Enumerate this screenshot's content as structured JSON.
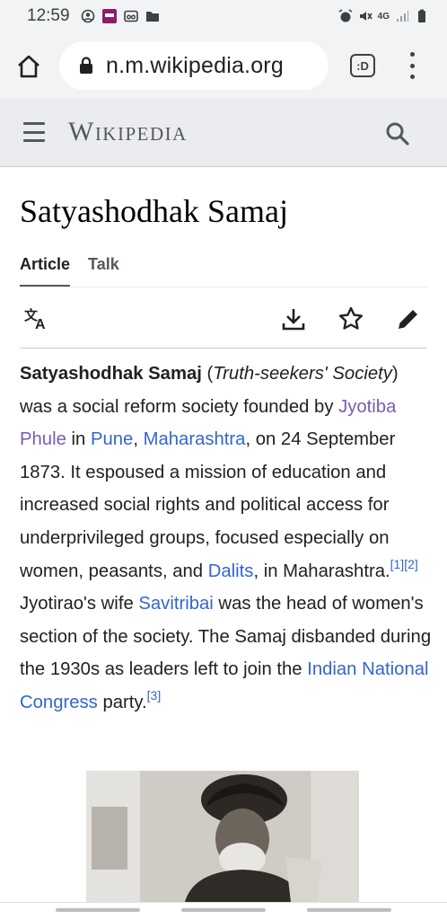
{
  "status_bar": {
    "time": "12:59",
    "network": "4G"
  },
  "browser": {
    "url": "n.m.wikipedia.org",
    "tab_switcher_label": ":D"
  },
  "header": {
    "wordmark": "Wikipedia"
  },
  "article": {
    "title": "Satyashodhak Samaj",
    "tabs": [
      {
        "label": "Article",
        "active": true
      },
      {
        "label": "Talk",
        "active": false
      }
    ],
    "paragraph": {
      "bold_term": "Satyashodhak Samaj",
      "paren_open": " (",
      "italic_term": "Truth-seekers' Society",
      "paren_close": ")",
      "t1": " was a social reform society founded by ",
      "link_jyotiba": "Jyotiba Phule",
      "t2": " in ",
      "link_pune": "Pune",
      "t3": ", ",
      "link_maharashtra": "Maharashtra",
      "t4": ", on 24 September 1873. It espoused a mission of education and increased social rights and political access for underprivileged groups, focused especially on women, peasants, and ",
      "link_dalits": "Dalits",
      "t5": ", in Maharashtra.",
      "ref1": "[1]",
      "ref2": "[2]",
      "t6": " Jyotirao's wife ",
      "link_savitribai": "Savitribai",
      "t7": " was the head of women's section of the society. The Samaj disbanded during the 1930s as leaders left to join the ",
      "link_inc": "Indian National Congress",
      "t8": " party.",
      "ref3": "[3]"
    }
  },
  "colors": {
    "link": "#3366cc",
    "visited_link": "#795cb2",
    "header_bg": "#eaecf0",
    "browser_bg": "#f1f3f4"
  }
}
